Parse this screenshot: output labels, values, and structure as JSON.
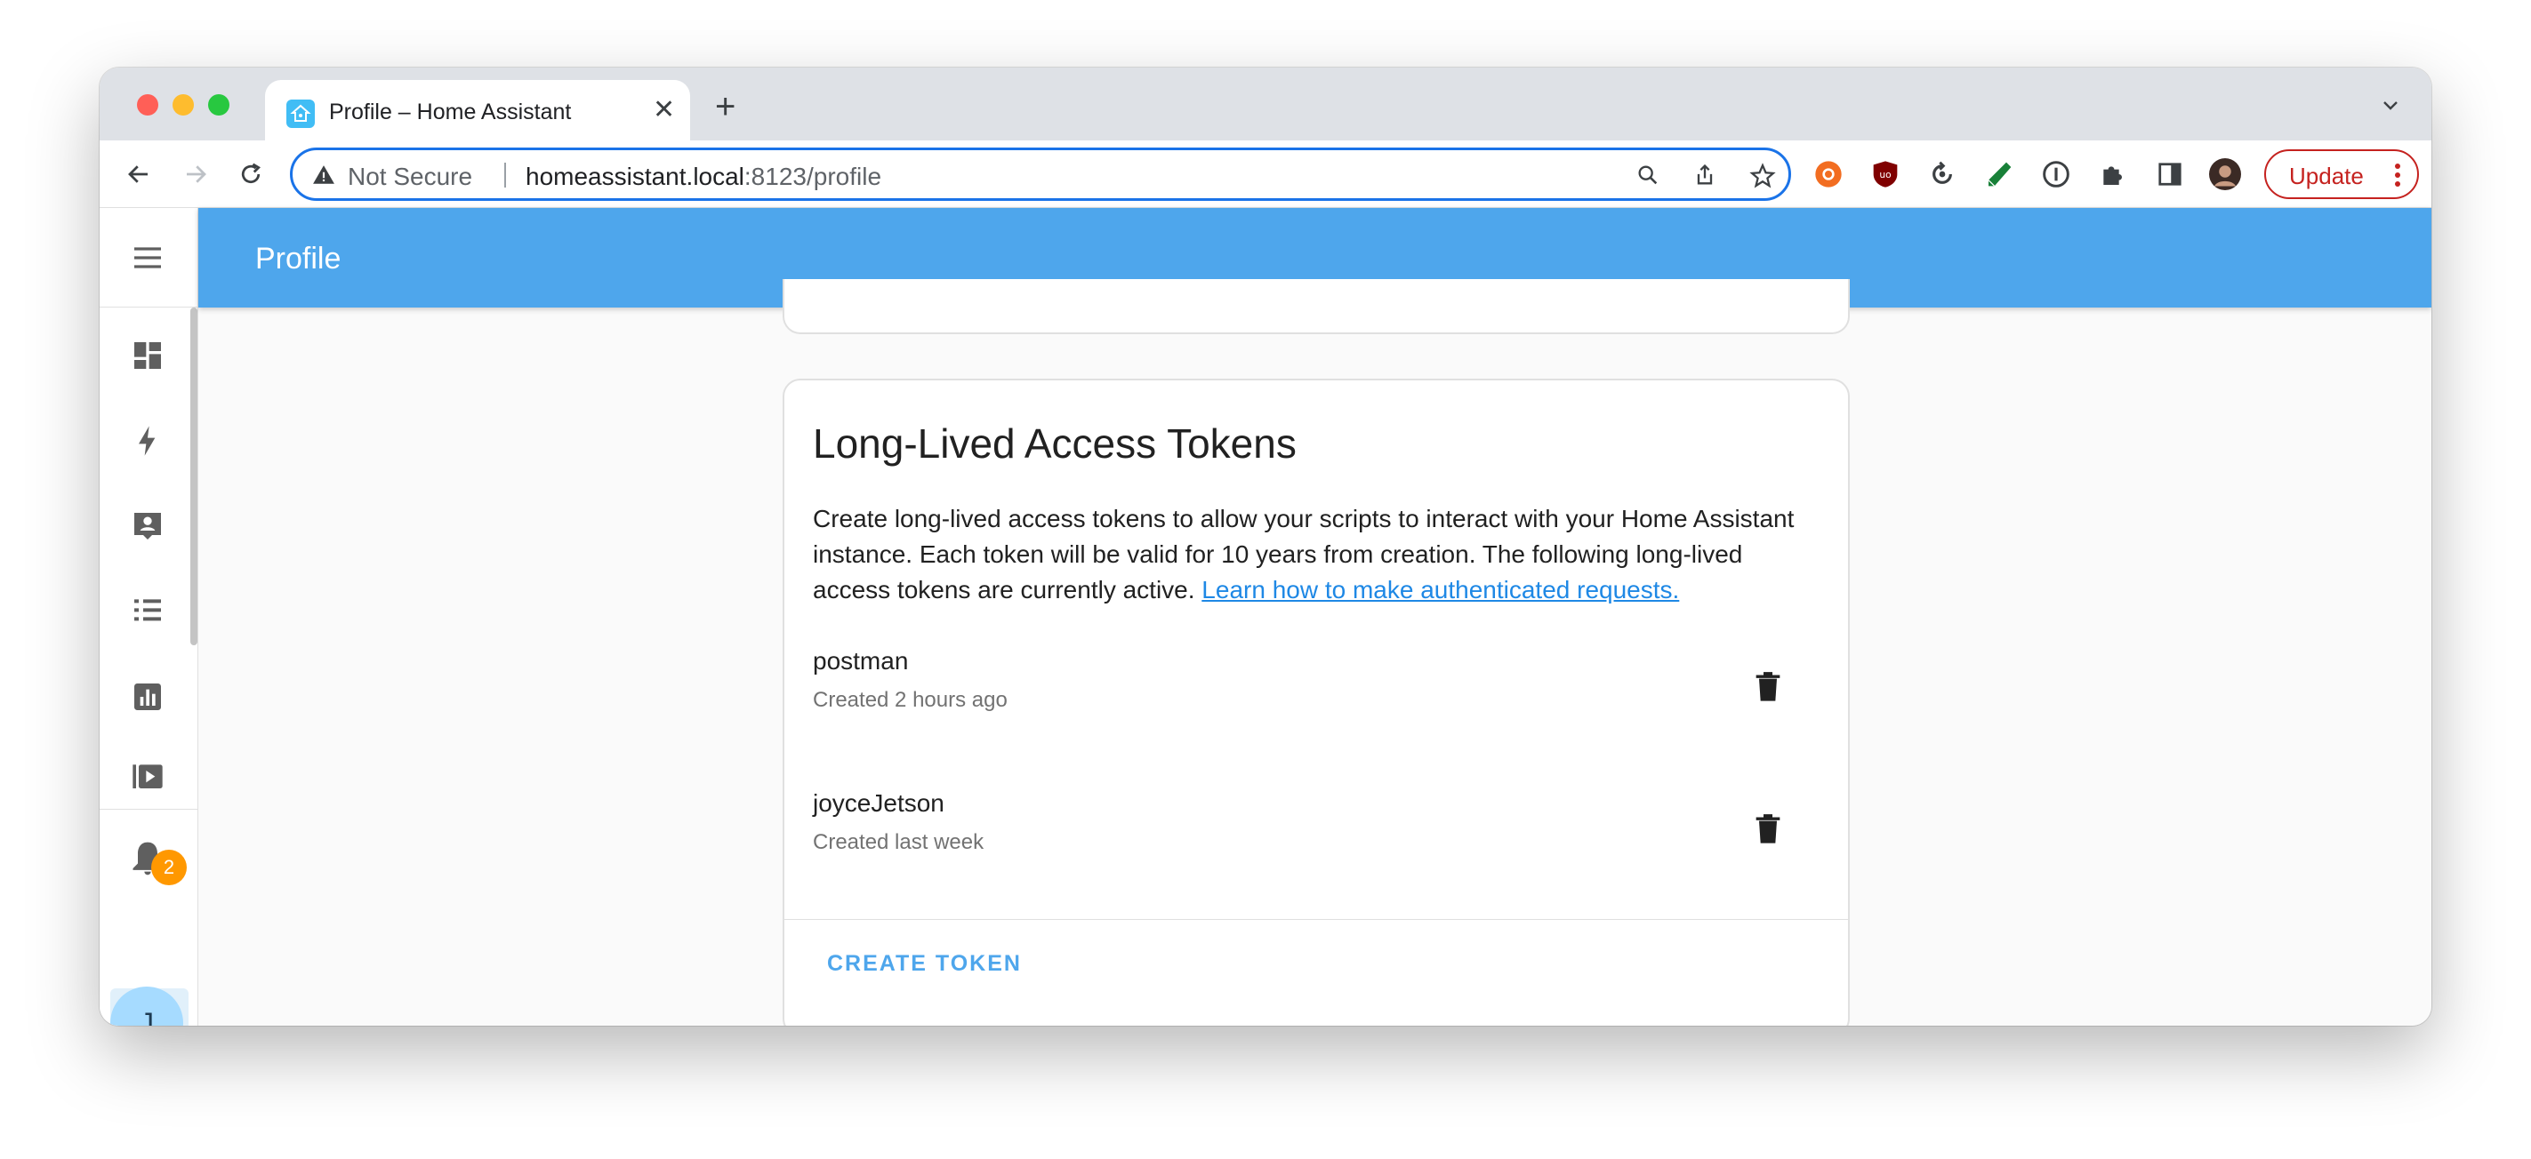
{
  "browser": {
    "tab": {
      "title": "Profile – Home Assistant",
      "close": "✕"
    },
    "new_tab": "+",
    "omnibox": {
      "security_label": "Not Secure",
      "url_host": "homeassistant.local",
      "url_rest": ":8123/profile"
    },
    "update_button": "Update"
  },
  "app": {
    "header_title": "Profile",
    "sidebar": {
      "items": [
        "dashboard",
        "energy",
        "logbook",
        "history",
        "statistics",
        "media"
      ],
      "notification_count": "2",
      "avatar_initial": "J"
    },
    "tokens_card": {
      "title": "Long-Lived Access Tokens",
      "description": "Create long-lived access tokens to allow your scripts to interact with your Home Assistant instance. Each token will be valid for 10 years from creation. The following long-lived access tokens are currently active.",
      "link_text": "Learn how to make authenticated requests.",
      "tokens": [
        {
          "name": "postman",
          "created": "Created 2 hours ago"
        },
        {
          "name": "joyceJetson",
          "created": "Created last week"
        }
      ],
      "create_button": "CREATE TOKEN"
    }
  },
  "colors": {
    "header": "#4ea6ec",
    "accent": "#4ea6ec",
    "badge": "#ff9800",
    "update": "#c5221f"
  }
}
